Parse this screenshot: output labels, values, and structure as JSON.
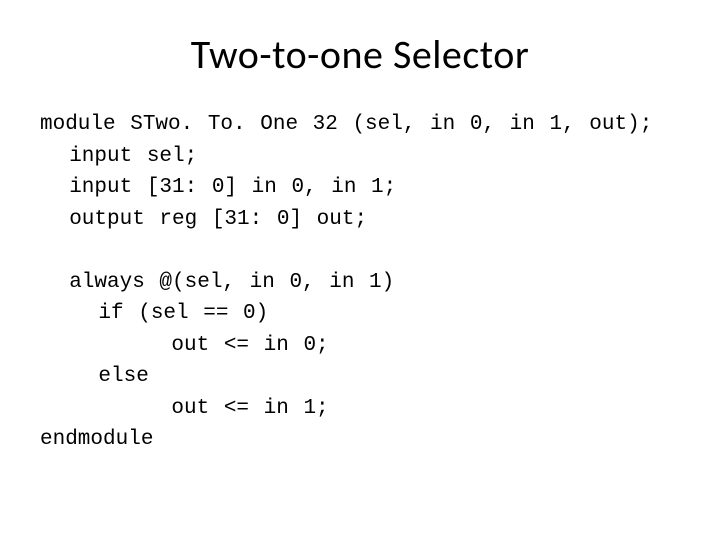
{
  "title": "Two-to-one Selector",
  "code": {
    "l1": "module STwo. To. One 32 (sel, in 0, in 1, out);",
    "l2": "  input sel;",
    "l3": "  input [31: 0] in 0, in 1;",
    "l4": "  output reg [31: 0] out;",
    "blank": "",
    "l5": "  always @(sel, in 0, in 1)",
    "l6": "    if (sel == 0)",
    "l7": "         out <= in 0;",
    "l8": "    else",
    "l9": "         out <= in 1;",
    "l10": "endmodule"
  }
}
